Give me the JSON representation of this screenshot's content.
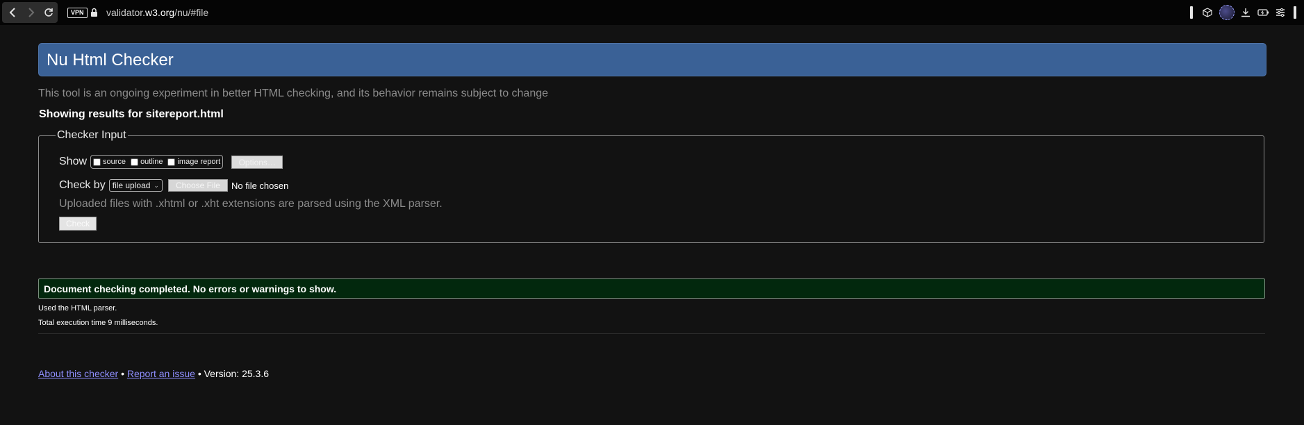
{
  "browser": {
    "vpn_badge": "VPN",
    "url_prefix": "validator.",
    "url_domain": "w3.org",
    "url_path": "/nu/#file",
    "icons": [
      "back-icon",
      "forward-icon",
      "reload-icon",
      "lock-icon",
      "cube-icon",
      "avatar",
      "download-icon",
      "battery-icon",
      "menu-icon"
    ]
  },
  "page": {
    "title": "Nu Html Checker",
    "tagline": "This tool is an ongoing experiment in better HTML checking, and its behavior remains subject to change",
    "showing": "Showing results for sitereport.html"
  },
  "checker_input": {
    "legend": "Checker Input",
    "show_label": "Show",
    "options": [
      {
        "label": "source",
        "checked": false
      },
      {
        "label": "outline",
        "checked": false
      },
      {
        "label": "image report",
        "checked": false
      }
    ],
    "options_button": "Options…",
    "check_by_label": "Check by",
    "check_by_value": "file upload",
    "choose_file_button": "Choose File",
    "file_status": "No file chosen",
    "xml_note": "Uploaded files with .xhtml or .xht extensions are parsed using the XML parser.",
    "check_button": "Check"
  },
  "results": {
    "success_message": "Document checking completed. No errors or warnings to show.",
    "parser_note": "Used the HTML parser.",
    "execution_time": "Total execution time 9 milliseconds."
  },
  "footer": {
    "about_link": "About this checker",
    "separator": "•",
    "report_link": "Report an issue",
    "version": "Version: 25.3.6"
  },
  "colors": {
    "banner": "#3a6196",
    "page_bg": "#121212",
    "success_bg": "#02280d",
    "link": "#8f8fff"
  }
}
